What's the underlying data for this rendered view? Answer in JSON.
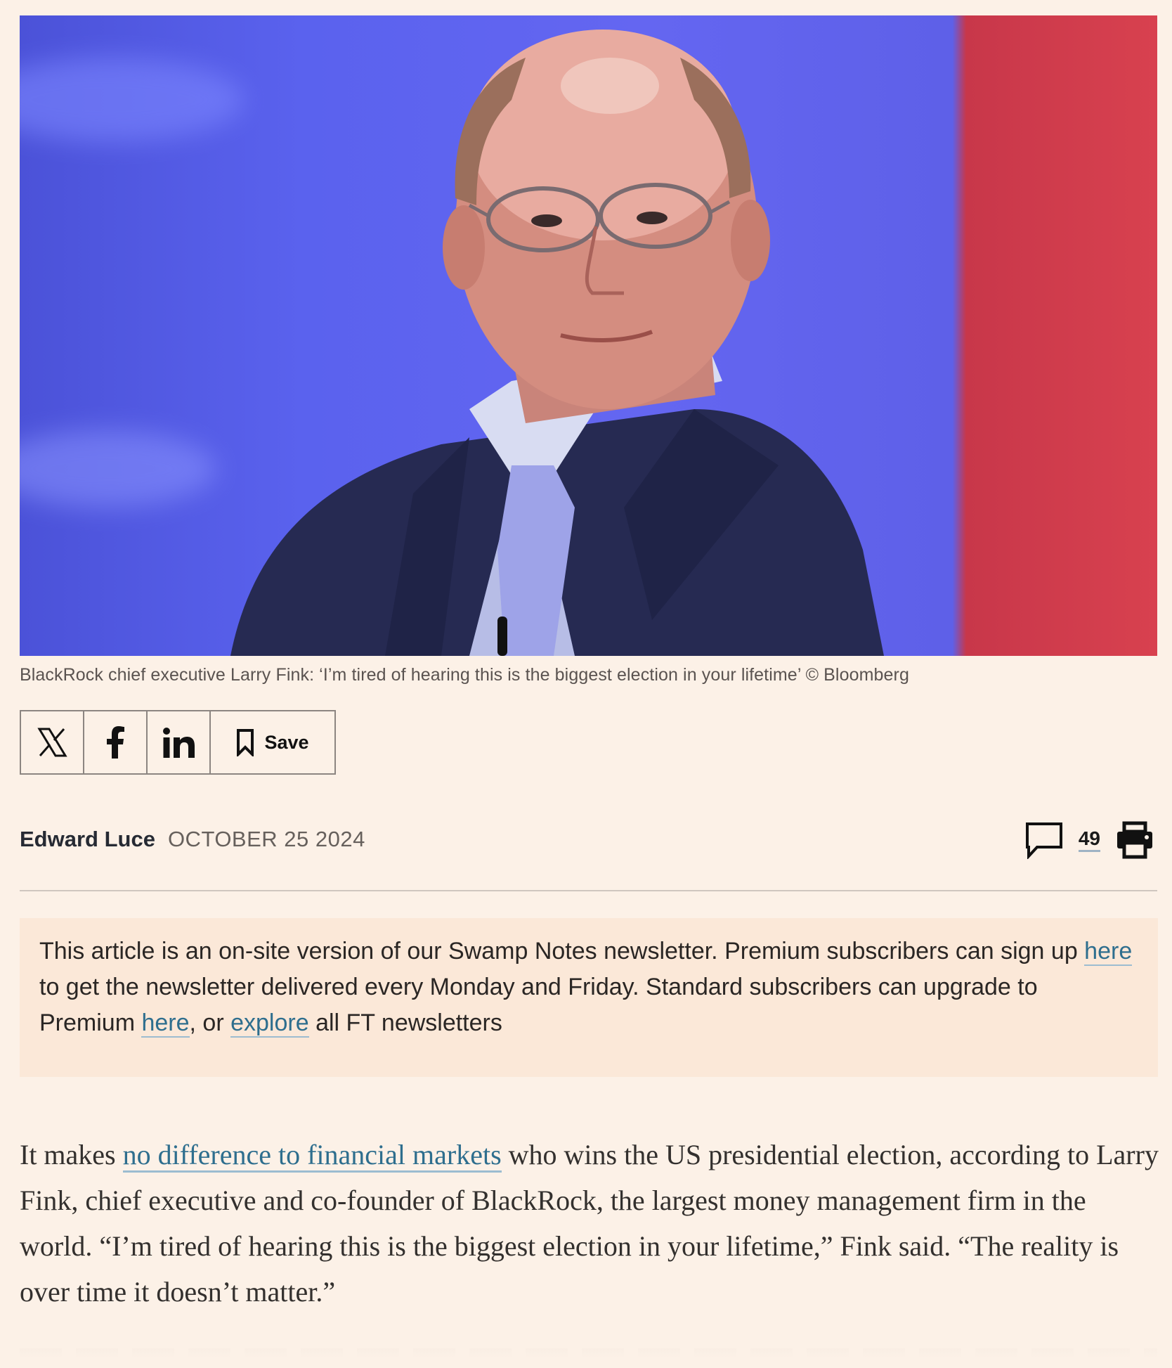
{
  "photo": {
    "subject": "BlackRock chief executive Larry Fink"
  },
  "caption": "BlackRock chief executive Larry Fink: ‘I’m tired of hearing this is the biggest election in your lifetime’ © Bloomberg",
  "share": {
    "icons": [
      "x-icon",
      "facebook-icon",
      "linkedin-icon",
      "bookmark-icon"
    ],
    "save_label": "Save"
  },
  "byline": {
    "author": "Edward Luce",
    "date": "OCTOBER 25 2024",
    "comment_count": "49"
  },
  "promo": {
    "p1": "This article is an on-site version of our Swamp Notes newsletter. Premium subscribers can sign up ",
    "link1": "here",
    "p2": " to get the newsletter delivered every Monday and Friday. Standard subscribers can upgrade to Premium ",
    "link2": "here",
    "p3": ", or ",
    "link3": "explore",
    "p4": " all FT newsletters"
  },
  "body": {
    "p1_start": "It makes ",
    "p1_link": "no difference to financial markets",
    "p1_rest": " who wins the US presidential election, according to Larry Fink, chief executive and co-founder of BlackRock, the largest money management firm in the world. “I’m tired of hearing this is the biggest election in your lifetime,” Fink said. “The reality is over time it doesn’t matter.”"
  },
  "colors": {
    "page_bg": "#fcf1e7",
    "promo_bg": "#fbe8d8",
    "link": "#2e6e8e"
  }
}
